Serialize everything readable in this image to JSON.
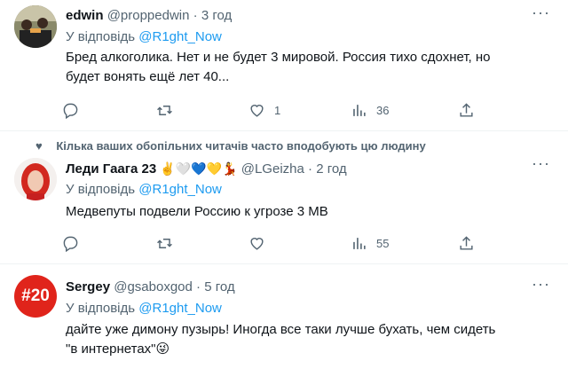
{
  "tweets": [
    {
      "name": "edwin",
      "handle": "@proppedwin",
      "dot": "·",
      "time": "3 год",
      "replying_label": "У відповідь",
      "replying_to": "@R1ght_Now",
      "text_line1": "Бред алкоголика. Нет и не будет 3 мировой. Россия тихо сдохнет, но",
      "text_line2": "будет вонять ещё лет 40...",
      "likes": "1",
      "views": "36"
    },
    {
      "social_context": "Кілька ваших обопільних читачів часто вподобують цю людину",
      "name": "Леди Гаага 23",
      "name_emojis": "✌️🤍💙💛💃",
      "handle": "@LGeizha",
      "dot": "·",
      "time": "2 год",
      "replying_label": "У відповідь",
      "replying_to": "@R1ght_Now",
      "text_line1": "Медвепуты подвели Россию к угрозе 3 МВ",
      "likes": "",
      "views": "55"
    },
    {
      "name": "Sergey",
      "handle": "@gsaboxgod",
      "dot": "·",
      "time": "5 год",
      "replying_label": "У відповідь",
      "replying_to": "@R1ght_Now",
      "text_line1": "дайте уже димону пузырь! Иногда все таки лучше бухать, чем сидеть",
      "text_line2": "\"в интернетах\"😜",
      "avatar_text": "#20"
    }
  ],
  "icons": {
    "more": "more-dots-icon",
    "reply": "reply-icon",
    "retweet": "retweet-icon",
    "like": "heart-icon",
    "views": "views-bar-icon",
    "share": "share-icon"
  },
  "colors": {
    "link": "#1d9bf0",
    "secondary": "#536471",
    "avatar3_bg": "#e0241b"
  }
}
